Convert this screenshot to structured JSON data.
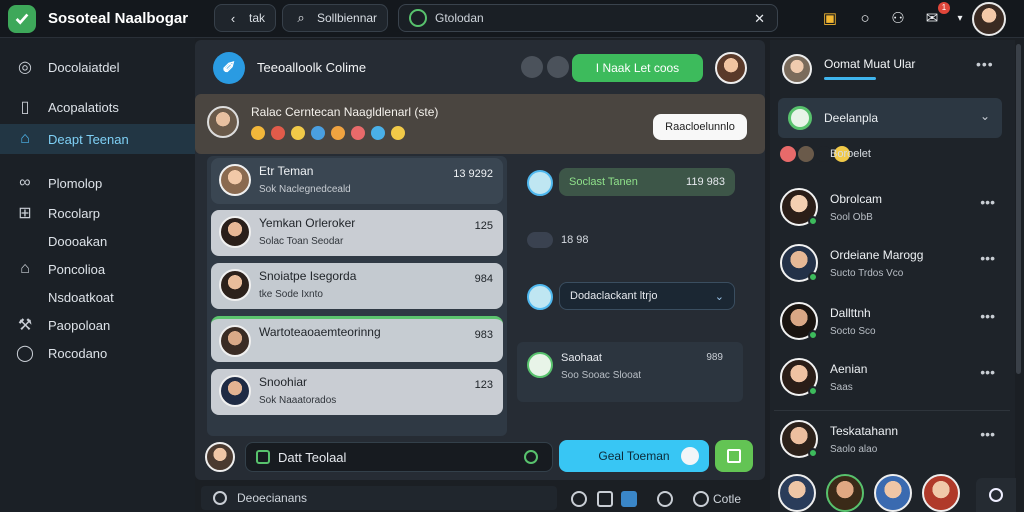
{
  "topbar": {
    "brand": "Sosoteal Naalbogar",
    "tab1": "tak",
    "tab2": "Sollbiennar",
    "search_value": "Gtolodan",
    "notif_count": "1"
  },
  "sidebar": {
    "items": [
      {
        "label": "Docolaiatdel",
        "icon": "circle-icon"
      },
      {
        "label": "Acopalatiots",
        "icon": "document-icon"
      },
      {
        "label": "Deapt Teenan",
        "icon": "home-icon",
        "active": true
      },
      {
        "label": "Plomolop",
        "icon": "link-icon"
      },
      {
        "label": "Rocolarp",
        "icon": "grid-icon"
      },
      {
        "label": "Doooakan",
        "icon": ""
      },
      {
        "label": "Poncolioa",
        "icon": "home-icon"
      },
      {
        "label": "Nsdoatkoat",
        "icon": ""
      },
      {
        "label": "Paopoloan",
        "icon": "wrench-icon"
      },
      {
        "label": "Rocodano",
        "icon": "chat-icon"
      }
    ]
  },
  "chat": {
    "title": "Teeoalloolk  Colime",
    "green_button": "I Naak Let coos",
    "banner_title": "Ralac Cerntecan Naagldlenarl (ste)",
    "banner_button": "Raacloelunnlo",
    "rows": [
      {
        "name": "Etr Teman",
        "sub": "Sok  Naclegnedceald",
        "time": "13 9292"
      },
      {
        "name": "Yemkan Orleroker",
        "sub": "Solac  Toan  Seodar",
        "time": "125"
      },
      {
        "name": "Snoiatpe Isegorda",
        "sub": "tke  Sode  Ixnto",
        "time": "984"
      },
      {
        "name": "Wartoteaoaemteorinng",
        "sub": "",
        "time": "983"
      },
      {
        "name": "Snoohiar",
        "sub": "Sok  Naaatorados",
        "time": "123"
      }
    ],
    "bubble1": "Soclast  Tanen",
    "bubble1_time": "119 983",
    "stamp": "18 98",
    "bubble2": "Dodaclackant ltrjo",
    "card_title": "Saohaat",
    "card_sub": "Soo  Sooac  Slooat",
    "card_time": "989",
    "composer_value": "Datt  Teolaal",
    "send_label": "Geal Toeman"
  },
  "bottombar": {
    "label": "Deoecianans",
    "right": "Cotle"
  },
  "right": {
    "title": "Oomat Muat Ular",
    "select_label": "Deelanpla",
    "sub": "Boroelet",
    "contacts": [
      {
        "name": "Obrolcam",
        "sub": "Sool  ObB"
      },
      {
        "name": "Ordeiane Marogg",
        "sub": "Sucto  Trdos  Vco"
      },
      {
        "name": "Dallttnh",
        "sub": "Socto  Sco"
      },
      {
        "name": "Aenian",
        "sub": "Saas"
      },
      {
        "name": "Teskatahann",
        "sub": "Saolo  alao"
      }
    ]
  },
  "colors": {
    "accent_green": "#3dbb5c",
    "accent_blue": "#38c6f4",
    "active_nav": "#4fb8ef"
  }
}
